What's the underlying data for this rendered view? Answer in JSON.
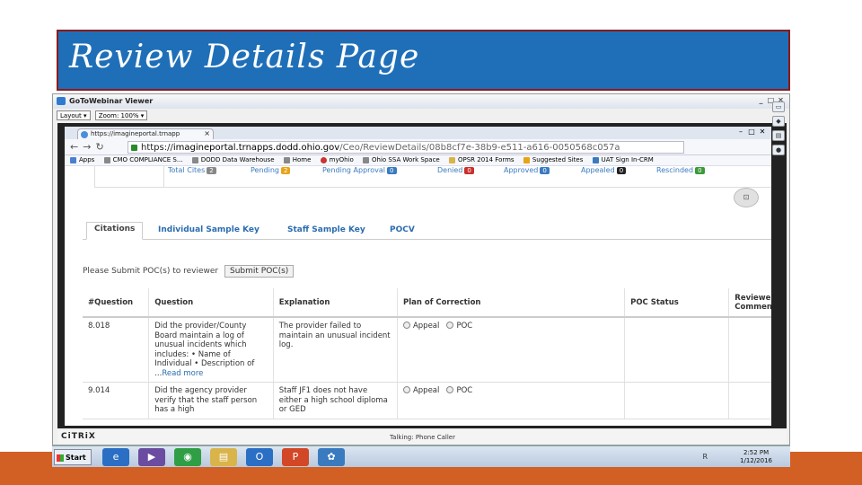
{
  "slide": {
    "title": "Review Details Page"
  },
  "gtw": {
    "title": "GoToWebinar Viewer",
    "layout_label": "Layout ▾",
    "zoom_label": "Zoom: 100% ▾",
    "ctrls": [
      "_",
      "□",
      "✕"
    ]
  },
  "browser": {
    "tab_title": "https://imagineportal.trnapp",
    "tab_close": "×",
    "url_prefix": "https://",
    "url_domain": "imagineportal.trnapps.dodd.ohio.gov",
    "url_path": "/Ceo/ReviewDetails/08b8cf7e-38b9-e511-a616-0050568c057a",
    "bookmarks": [
      "Apps",
      "CMO COMPLIANCE S...",
      "DODD Data Warehouse",
      "Home",
      "myOhio",
      "Ohio SSA Work Space",
      "OPSR 2014 Forms",
      "Suggested Sites",
      "UAT Sign In-CRM"
    ]
  },
  "counts": [
    {
      "label": "Total Cites",
      "value": "2",
      "color": "#888888"
    },
    {
      "label": "Pending",
      "value": "2",
      "color": "#e8a317"
    },
    {
      "label": "Pending Approval",
      "value": "0",
      "color": "#3a7bbf"
    },
    {
      "label": "Denied",
      "value": "0",
      "color": "#c9302c"
    },
    {
      "label": "Approved",
      "value": "0",
      "color": "#3a7bbf"
    },
    {
      "label": "Appealed",
      "value": "0",
      "color": "#222222"
    },
    {
      "label": "Rescinded",
      "value": "0",
      "color": "#3a9a3a"
    }
  ],
  "tabs": [
    "Citations",
    "Individual Sample Key",
    "Staff Sample Key",
    "POCV"
  ],
  "submit": {
    "prompt": "Please Submit POC(s) to reviewer",
    "button": "Submit POC(s)"
  },
  "table": {
    "headers": [
      "#Question",
      "Question",
      "Explanation",
      "Plan of Correction",
      "POC Status",
      "Reviewer Comments"
    ],
    "rows": [
      {
        "num": "8.018",
        "question": "Did the provider/County Board maintain a log of unusual incidents which includes: • Name of Individual • Description of ...",
        "readmore": "Read more",
        "explanation": "The provider failed to maintain an unusual incident log.",
        "opt1": "Appeal",
        "opt2": "POC"
      },
      {
        "num": "9.014",
        "question": "Did the agency provider verify that the staff person has a high",
        "readmore": "",
        "explanation": "Staff JF1 does not have either a high school diploma or GED",
        "opt1": "Appeal",
        "opt2": "POC"
      }
    ]
  },
  "citrix": {
    "logo": "CiTRiX",
    "talking": "Talking: Phone Caller"
  },
  "taskbar": {
    "start": "Start",
    "time": "2:52 PM",
    "date": "1/12/2016",
    "tray": "R"
  },
  "accent": "#d25f23"
}
